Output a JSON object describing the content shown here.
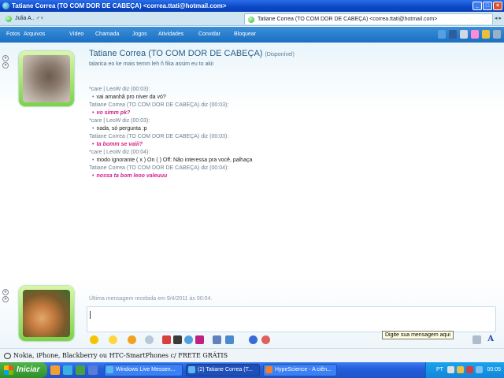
{
  "window": {
    "title": "Tatiane Correa (TO COM DOR DE CABEÇA) <correa.ttati@hotmail.com>",
    "buttons": [
      "_",
      "□",
      "×"
    ]
  },
  "tabs": [
    {
      "label": "Julia A.. ♂♀"
    },
    {
      "label": "Tatiane Correa (TO COM DOR DE CABEÇA) <correa.ttati@hotmail.com>"
    }
  ],
  "menu": {
    "items": [
      "Fotos",
      "Arquivos",
      "Vídeo",
      "Chamada",
      "Jogos",
      "Atividades",
      "Convidar",
      "Bloquear"
    ]
  },
  "contact": {
    "name": "Tatiane Correa (TO COM DOR DE CABEÇA)",
    "availability": "(Disponível)",
    "personal_message": "talarica eo ke mais temm leh ñ fika assim eu to akii"
  },
  "conversation": [
    {
      "type": "header",
      "text": "*care | LeoW diz (00:03):"
    },
    {
      "type": "message",
      "style": "normal",
      "text": "vai amanhã pro niver da vó?"
    },
    {
      "type": "header",
      "text": "Tatiane Correa (TO COM DOR DE CABEÇA) diz (00:03):"
    },
    {
      "type": "message",
      "style": "pink",
      "text": "vo simm pk?"
    },
    {
      "type": "header",
      "text": "*care | LeoW diz (00:03):"
    },
    {
      "type": "message",
      "style": "normal",
      "text": "nada, só pergunta :p"
    },
    {
      "type": "header",
      "text": "Tatiane Correa (TO COM DOR DE CABEÇA) diz (00:03):"
    },
    {
      "type": "message",
      "style": "pink",
      "text": "ta bomm se vaiii?"
    },
    {
      "type": "header",
      "text": "*care | LeoW diz (00:04):"
    },
    {
      "type": "message",
      "style": "normal",
      "text": "modo ignorante ( x ) On  (  ) Off: Não interessa pra você, palhaça"
    },
    {
      "type": "header",
      "text": "Tatiane Correa (TO COM DOR DE CABEÇA) diz (00:04):"
    },
    {
      "type": "message",
      "style": "pink",
      "text": "nossa ta bom leoo valeuuu"
    }
  ],
  "last_received": "Última mensagem recebida em 9/4/2011 às 00:04.",
  "input": {
    "value": "",
    "tooltip": "Digite sua mensagem aqui"
  },
  "promo": {
    "text": "Nokia, iPhone, Blackberry ou HTC-SmartPhones c/ FRETE GRÁTIS"
  },
  "taskbar": {
    "start_label": "Iniciar",
    "tasks": [
      {
        "label": "Windows Live Messen..."
      },
      {
        "label": "(2) Tatiane Correa (T..."
      },
      {
        "label": "HypeScience - A ciên..."
      }
    ],
    "language": "PT",
    "clock": "00:05"
  },
  "colors": {
    "accent": "#1a6fc2",
    "pink_message": "#d2208c",
    "avatar_frame": "#7bd24a"
  }
}
